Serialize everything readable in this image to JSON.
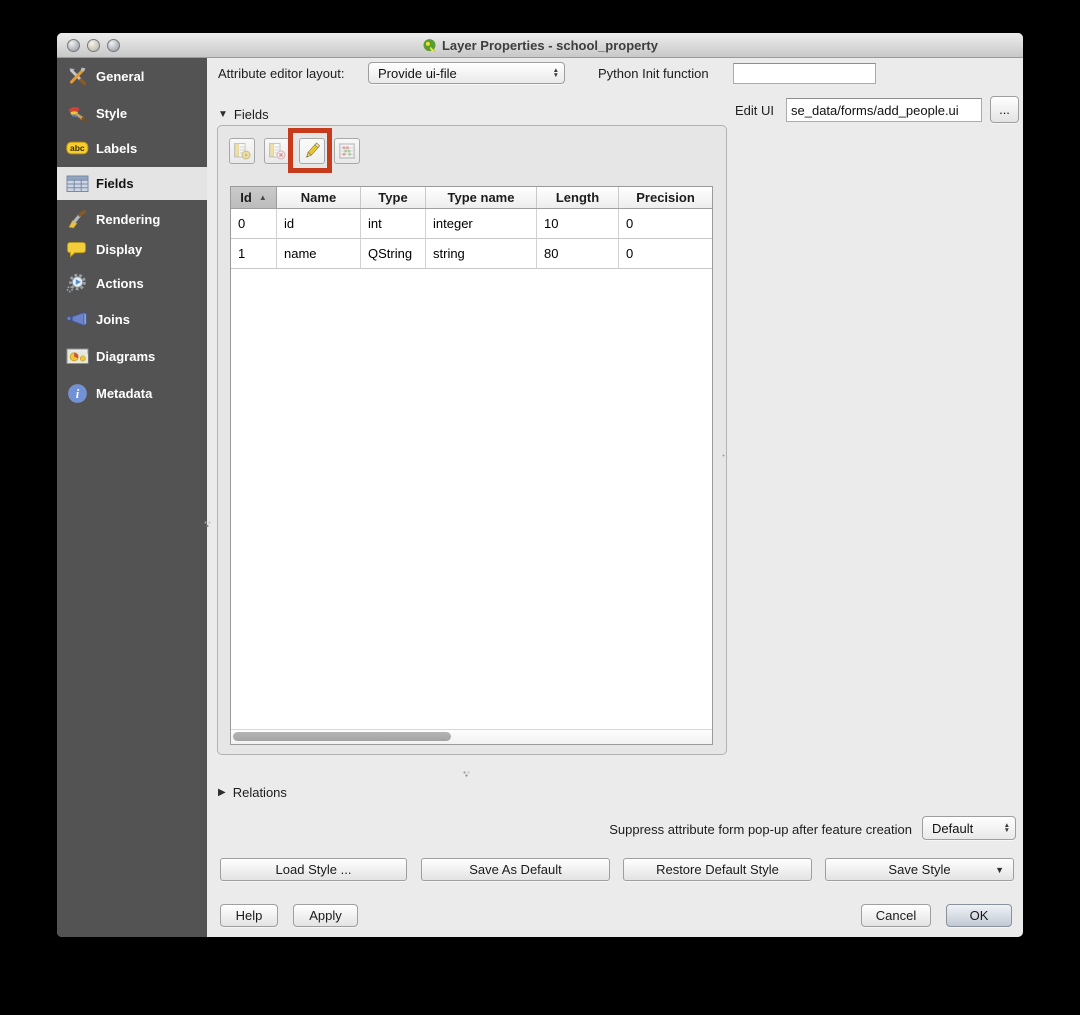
{
  "window": {
    "title": "Layer Properties - school_property",
    "app_icon": "qgis-logo-icon"
  },
  "sidebar": {
    "items": [
      {
        "label": "General",
        "icon": "tools-icon",
        "selected": false
      },
      {
        "label": "Style",
        "icon": "paintbrush-palette-icon",
        "selected": false
      },
      {
        "label": "Labels",
        "icon": "abc-tag-icon",
        "selected": false
      },
      {
        "label": "Fields",
        "icon": "table-icon",
        "selected": true
      },
      {
        "label": "Rendering",
        "icon": "brush-icon",
        "selected": false
      },
      {
        "label": "Display",
        "icon": "speech-bubble-icon",
        "selected": false
      },
      {
        "label": "Actions",
        "icon": "gear-play-icon",
        "selected": false
      },
      {
        "label": "Joins",
        "icon": "join-horn-icon",
        "selected": false
      },
      {
        "label": "Diagrams",
        "icon": "map-chart-icon",
        "selected": false
      },
      {
        "label": "Metadata",
        "icon": "info-icon",
        "selected": false
      }
    ]
  },
  "form": {
    "attribute_editor_layout_label": "Attribute editor layout:",
    "attribute_editor_layout_value": "Provide ui-file",
    "python_init_label": "Python Init function",
    "python_init_value": "",
    "edit_ui_label": "Edit UI",
    "edit_ui_value": "se_data/forms/add_people.ui",
    "browse_button_label": "..."
  },
  "fields_section": {
    "title": "Fields",
    "toolbar_icons": [
      "new-column-icon",
      "delete-column-icon",
      "toggle-editing-icon",
      "field-calculator-icon"
    ],
    "table": {
      "columns": [
        "Id",
        "Name",
        "Type",
        "Type name",
        "Length",
        "Precision"
      ],
      "sort_column": "Id",
      "sort_direction": "ascending",
      "rows": [
        [
          "0",
          "id",
          "int",
          "integer",
          "10",
          "0"
        ],
        [
          "1",
          "name",
          "QString",
          "string",
          "80",
          "0"
        ]
      ]
    }
  },
  "relations_section": {
    "title": "Relations"
  },
  "suppress_form": {
    "label": "Suppress attribute form pop-up after feature creation",
    "value": "Default"
  },
  "style_buttons": {
    "load": "Load Style ...",
    "save_as_default": "Save As Default",
    "restore_default": "Restore Default Style",
    "save_style": "Save Style"
  },
  "dialog_buttons": {
    "help": "Help",
    "apply": "Apply",
    "cancel": "Cancel",
    "ok": "OK"
  },
  "annotation": {
    "highlight_color": "#c63b1c",
    "highlighted_control": "toggle-editing-button"
  }
}
